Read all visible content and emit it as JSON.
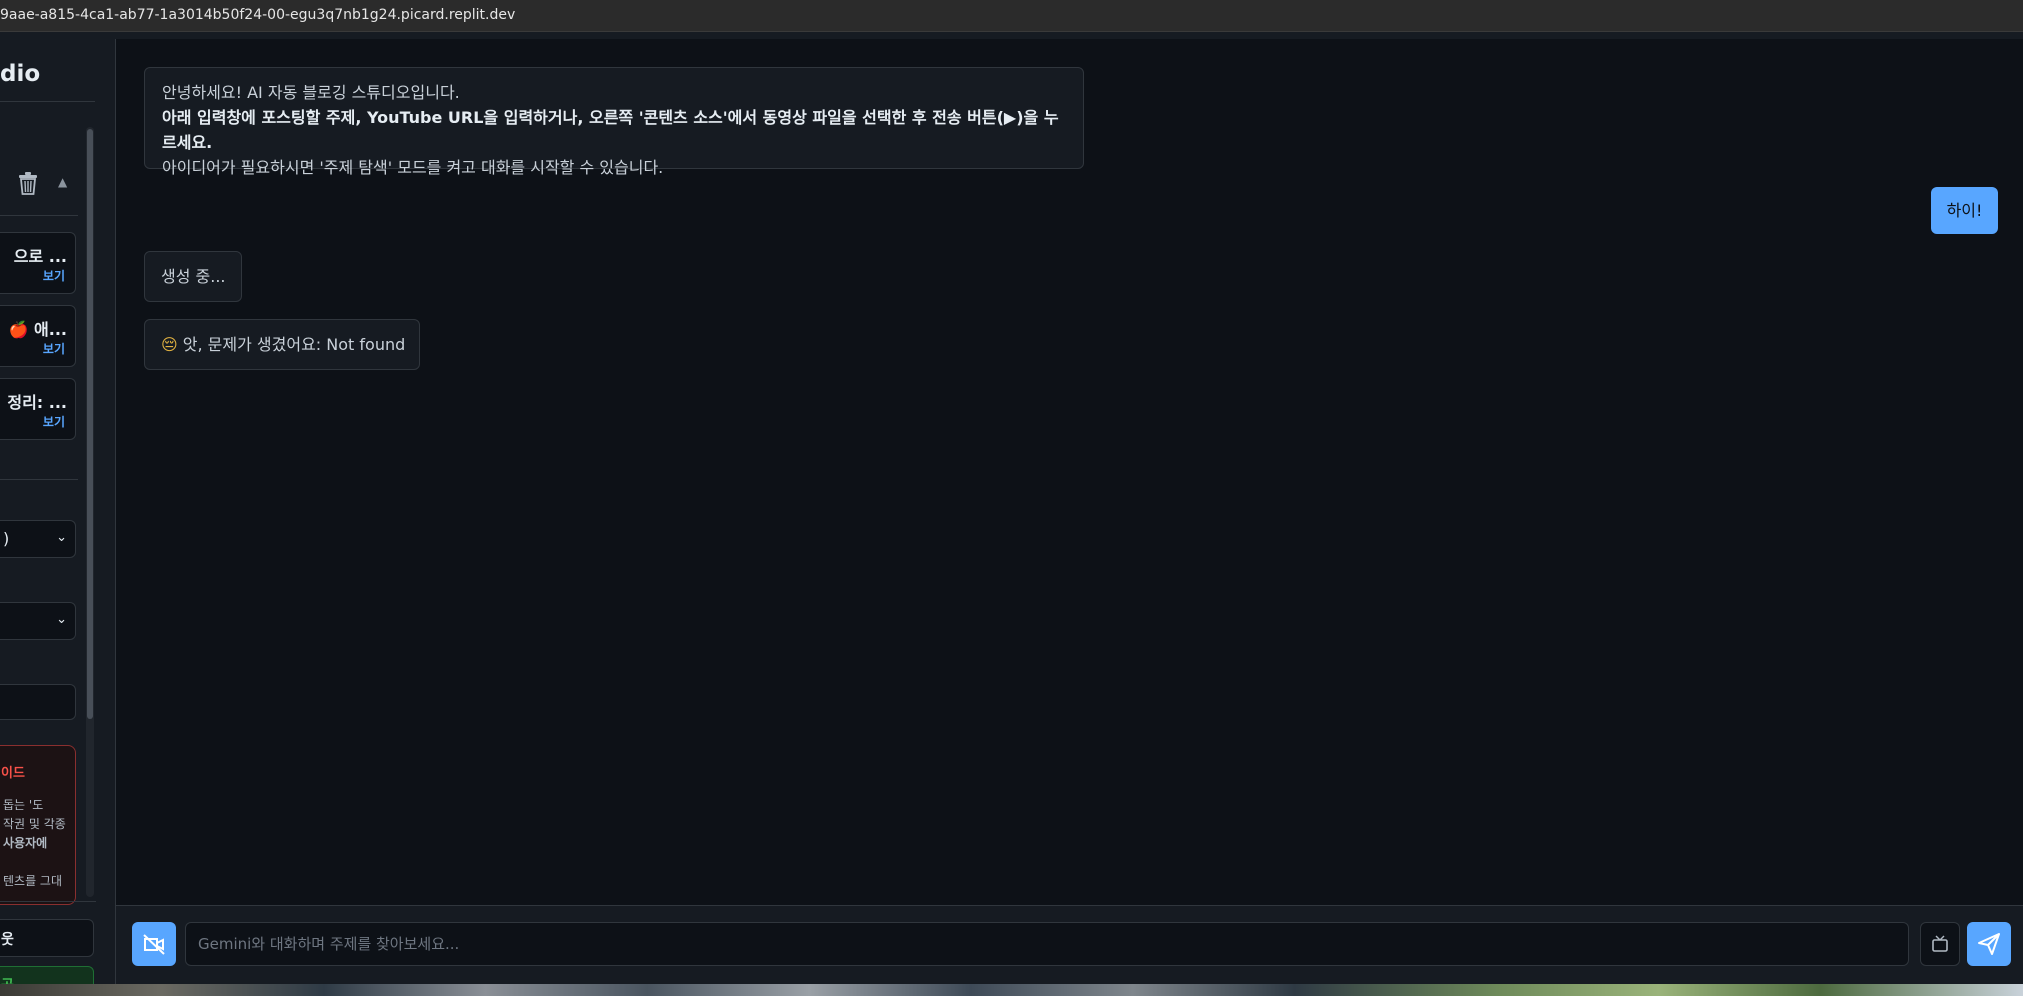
{
  "browser": {
    "url": "9aae-a815-4ca1-ab77-1a3014b50f24-00-egu3q7nb1g24.picard.replit.dev"
  },
  "sidebar": {
    "brand": "dio",
    "history": [
      {
        "title": "으로 ...",
        "view_label": "보기"
      },
      {
        "title": "🍎 애...",
        "view_label": "보기"
      },
      {
        "title": "정리: ...",
        "view_label": "보기"
      }
    ],
    "select_1": {
      "value": ")"
    },
    "select_2": {
      "value": ""
    },
    "input_1": {
      "value": ""
    },
    "guide": {
      "title": "이드",
      "lines": [
        "돕는 '도",
        "작권 및 각종",
        "사용자에",
        "",
        "텐츠를 그대"
      ]
    },
    "logout_label": "웃",
    "success_label": "공"
  },
  "chat": {
    "intro": {
      "line1": "안녕하세요! AI 자동 블로깅 스튜디오입니다.",
      "line2": "아래 입력창에 포스팅할 주제, YouTube URL을 입력하거나, 오른쪽 '콘텐츠 소스'에서 동영상 파일을 선택한 후 전송 버튼(▶)을 누르세요.",
      "line3": "아이디어가 필요하시면 '주제 탐색' 모드를 켜고 대화를 시작할 수 있습니다."
    },
    "user_message": "하이!",
    "generating": "생성 중...",
    "error": {
      "emoji": "😔",
      "text": "앗, 문제가 생겼어요: Not found"
    }
  },
  "input": {
    "placeholder": "Gemini와 대화하며 주제를 찾아보세요...",
    "value": ""
  },
  "colors": {
    "accent": "#58a6ff",
    "background": "#0d1117",
    "panel": "#161b22",
    "danger": "#f85149",
    "success": "#3fb950"
  },
  "icons": {
    "mode_toggle": "camera-off-icon",
    "source": "tv-icon",
    "send": "send-icon",
    "trash": "trash-icon"
  }
}
